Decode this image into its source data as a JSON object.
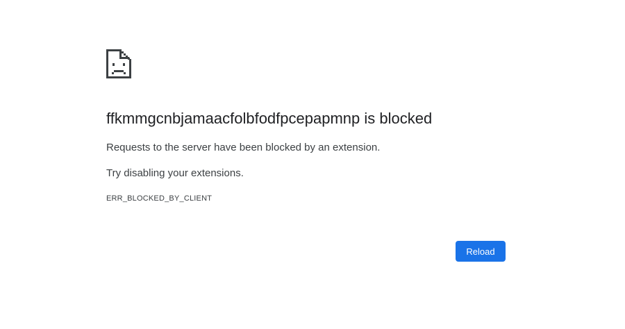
{
  "error_page": {
    "icon": "sad-document-icon",
    "title": "ffkmmgcnbjamaacfolbfodfpcepapmnp is blocked",
    "message_primary": "Requests to the server have been blocked by an extension.",
    "message_suggestion": "Try disabling your extensions.",
    "error_code": "ERR_BLOCKED_BY_CLIENT"
  },
  "actions": {
    "reload_label": "Reload"
  },
  "colors": {
    "button_bg": "#1a73e8",
    "icon": "#3c4043"
  }
}
